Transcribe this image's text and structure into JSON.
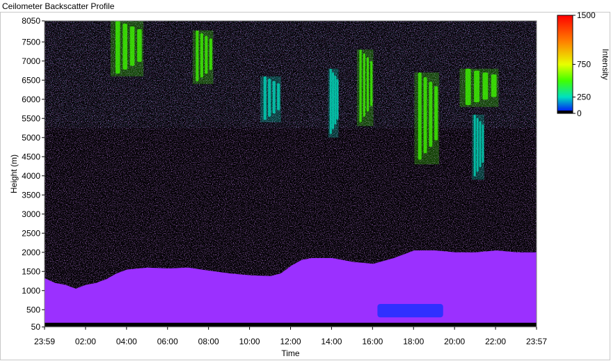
{
  "window": {
    "title": "Ceilometer Backscatter Profile"
  },
  "colors": {
    "background": "#000000",
    "boundary_layer": "#9b30ff",
    "noise": "#a040ff",
    "cloud_low": "#30a0ff",
    "cloud_mid": "#00e0c0",
    "cloud_high": "#70ff40",
    "plot_frame": "#808080"
  },
  "chart_data": {
    "type": "heatmap",
    "title": "",
    "xlabel": "Time",
    "ylabel": "Height (m)",
    "zlabel": "Intensity",
    "x_ticks": [
      "23:59",
      "02:00",
      "04:00",
      "06:00",
      "08:00",
      "10:00",
      "12:00",
      "14:00",
      "16:00",
      "18:00",
      "20:00",
      "22:00",
      "23:57"
    ],
    "x_range_hours": [
      -0.017,
      23.95
    ],
    "y_ticks": [
      50,
      500,
      1000,
      1500,
      2000,
      2500,
      3000,
      3500,
      4000,
      4500,
      5000,
      5500,
      6000,
      6500,
      7000,
      7500,
      8050
    ],
    "ylim": [
      50,
      8050
    ],
    "colorbar": {
      "range": [
        0,
        1500
      ],
      "ticks": [
        0,
        250,
        750,
        1500
      ],
      "stops": [
        {
          "value": 0,
          "color": "#0000ff"
        },
        {
          "value": 250,
          "color": "#00e0c0"
        },
        {
          "value": 500,
          "color": "#40ff00"
        },
        {
          "value": 750,
          "color": "#e8ff00"
        },
        {
          "value": 1100,
          "color": "#ff8000"
        },
        {
          "value": 1500,
          "color": "#ff0000"
        }
      ]
    },
    "boundary_layer_top": [
      [
        0.0,
        1320
      ],
      [
        0.5,
        1200
      ],
      [
        1.0,
        1150
      ],
      [
        1.5,
        1050
      ],
      [
        2.0,
        1150
      ],
      [
        2.5,
        1200
      ],
      [
        3.0,
        1300
      ],
      [
        3.5,
        1450
      ],
      [
        4.0,
        1550
      ],
      [
        5.0,
        1600
      ],
      [
        6.0,
        1580
      ],
      [
        7.0,
        1600
      ],
      [
        8.0,
        1520
      ],
      [
        9.0,
        1450
      ],
      [
        10.0,
        1400
      ],
      [
        11.0,
        1380
      ],
      [
        11.5,
        1450
      ],
      [
        12.0,
        1650
      ],
      [
        12.5,
        1800
      ],
      [
        13.0,
        1850
      ],
      [
        14.0,
        1850
      ],
      [
        15.0,
        1750
      ],
      [
        16.0,
        1700
      ],
      [
        17.0,
        1850
      ],
      [
        18.0,
        2050
      ],
      [
        19.0,
        2050
      ],
      [
        20.0,
        2000
      ],
      [
        21.0,
        2000
      ],
      [
        22.0,
        2050
      ],
      [
        23.0,
        2000
      ],
      [
        23.95,
        2000
      ]
    ],
    "cloud_features": [
      {
        "t_start": 3.2,
        "t_end": 4.8,
        "h_bottom": 6600,
        "h_top": 8050,
        "intensity": 280
      },
      {
        "t_start": 7.2,
        "t_end": 8.2,
        "h_bottom": 6400,
        "h_top": 7800,
        "intensity": 260
      },
      {
        "t_start": 10.5,
        "t_end": 11.5,
        "h_bottom": 5400,
        "h_top": 6600,
        "intensity": 200
      },
      {
        "t_start": 13.8,
        "t_end": 14.3,
        "h_bottom": 5000,
        "h_top": 6800,
        "intensity": 180
      },
      {
        "t_start": 15.2,
        "t_end": 16.0,
        "h_bottom": 5300,
        "h_top": 7300,
        "intensity": 420
      },
      {
        "t_start": 18.0,
        "t_end": 19.2,
        "h_bottom": 4300,
        "h_top": 6700,
        "intensity": 320
      },
      {
        "t_start": 20.2,
        "t_end": 22.1,
        "h_bottom": 5800,
        "h_top": 6800,
        "intensity": 300
      },
      {
        "t_start": 20.8,
        "t_end": 21.4,
        "h_bottom": 3900,
        "h_top": 5600,
        "intensity": 120
      }
    ],
    "low_feature": {
      "t_start": 16.2,
      "t_end": 19.4,
      "h_bottom": 300,
      "h_top": 650,
      "intensity": 20
    }
  }
}
